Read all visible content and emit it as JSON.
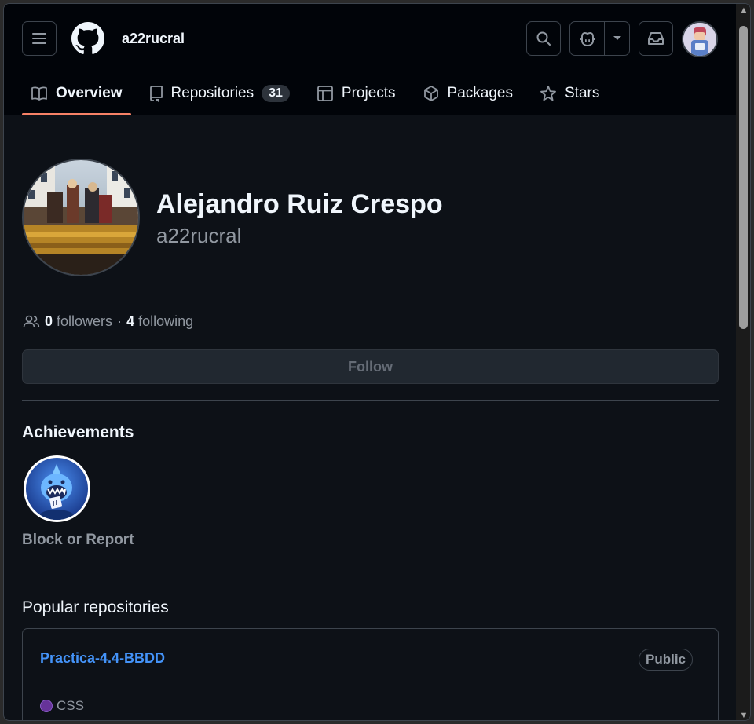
{
  "header": {
    "username": "a22rucral",
    "tabs": [
      {
        "label": "Overview",
        "icon": "book-icon",
        "active": true
      },
      {
        "label": "Repositories",
        "icon": "repo-icon",
        "count": "31"
      },
      {
        "label": "Projects",
        "icon": "table-icon"
      },
      {
        "label": "Packages",
        "icon": "package-icon"
      },
      {
        "label": "Stars",
        "icon": "star-icon"
      }
    ],
    "accent_color": "#f78166"
  },
  "profile": {
    "full_name": "Alejandro Ruiz Crespo",
    "login": "a22rucral",
    "followers_count": "0",
    "followers_label": "followers",
    "separator": "·",
    "following_count": "4",
    "following_label": "following",
    "follow_button": "Follow"
  },
  "achievements": {
    "title": "Achievements",
    "badge_icon": "shark-achievement-icon",
    "block_or_report": "Block or Report"
  },
  "popular": {
    "title": "Popular repositories",
    "repos": [
      {
        "name": "Practica-4.4-BBDD",
        "visibility": "Public",
        "language": "CSS",
        "language_color": "#663399"
      }
    ]
  }
}
